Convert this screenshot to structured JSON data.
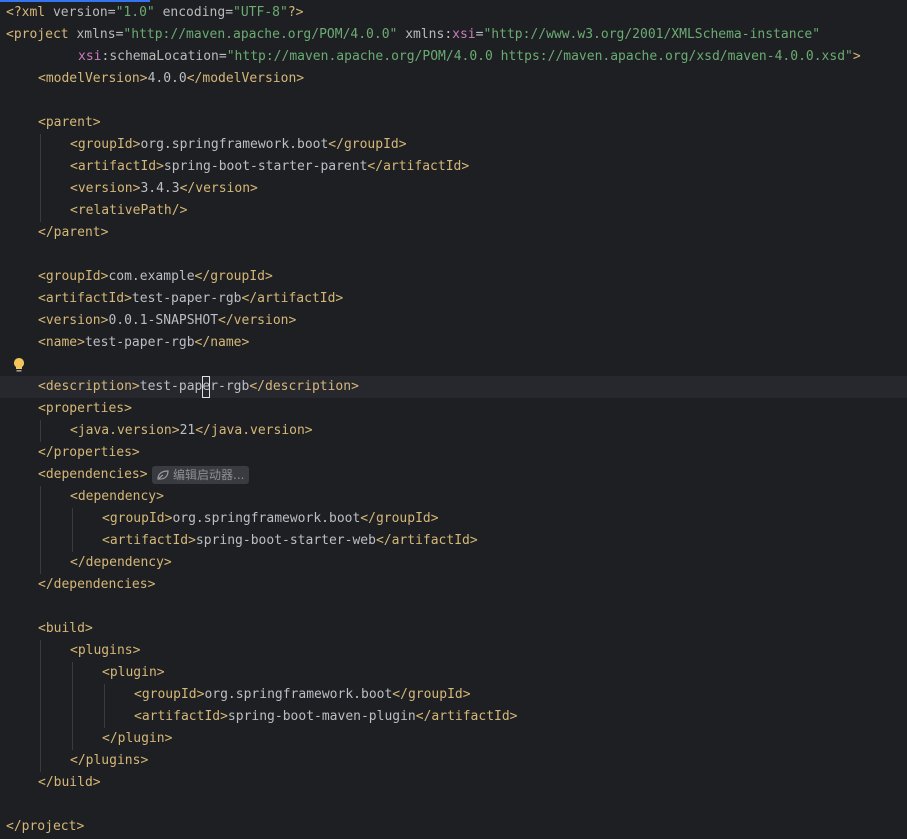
{
  "editor": {
    "file_lines": [
      {
        "indent": 0,
        "tokens": [
          {
            "t": "pi",
            "v": "<?"
          },
          {
            "t": "tag",
            "v": "xml "
          },
          {
            "t": "attr",
            "v": "version"
          },
          {
            "t": "txt",
            "v": "="
          },
          {
            "t": "str",
            "v": "\"1.0\""
          },
          {
            "t": "txt",
            "v": " "
          },
          {
            "t": "attr",
            "v": "encoding"
          },
          {
            "t": "txt",
            "v": "="
          },
          {
            "t": "str",
            "v": "\"UTF-8\""
          },
          {
            "t": "pi",
            "v": "?>"
          }
        ]
      },
      {
        "indent": 0,
        "tokens": [
          {
            "t": "tag",
            "v": "<project "
          },
          {
            "t": "attr",
            "v": "xmlns"
          },
          {
            "t": "txt",
            "v": "="
          },
          {
            "t": "str",
            "v": "\"http://maven.apache.org/POM/4.0.0\""
          },
          {
            "t": "txt",
            "v": " "
          },
          {
            "t": "attr",
            "v": "xmlns"
          },
          {
            "t": "txt",
            "v": ":"
          },
          {
            "t": "ns",
            "v": "xsi"
          },
          {
            "t": "txt",
            "v": "="
          },
          {
            "t": "str",
            "v": "\"http://www.w3.org/2001/XMLSchema-instance\""
          }
        ]
      },
      {
        "indent": 0,
        "pad": "         ",
        "tokens": [
          {
            "t": "ns",
            "v": "xsi"
          },
          {
            "t": "txt",
            "v": ":"
          },
          {
            "t": "attr",
            "v": "schemaLocation"
          },
          {
            "t": "txt",
            "v": "="
          },
          {
            "t": "str",
            "v": "\"http://maven.apache.org/POM/4.0.0 https://maven.apache.org/xsd/maven-4.0.0.xsd\""
          },
          {
            "t": "tag",
            "v": ">"
          }
        ]
      },
      {
        "indent": 1,
        "tokens": [
          {
            "t": "tag",
            "v": "<modelVersion>"
          },
          {
            "t": "txt",
            "v": "4.0.0"
          },
          {
            "t": "tag",
            "v": "</modelVersion>"
          }
        ]
      },
      {
        "indent": 0,
        "tokens": []
      },
      {
        "indent": 1,
        "tokens": [
          {
            "t": "tag",
            "v": "<parent>"
          }
        ]
      },
      {
        "indent": 2,
        "tokens": [
          {
            "t": "tag",
            "v": "<groupId>"
          },
          {
            "t": "txt",
            "v": "org.springframework.boot"
          },
          {
            "t": "tag",
            "v": "</groupId>"
          }
        ]
      },
      {
        "indent": 2,
        "tokens": [
          {
            "t": "tag",
            "v": "<artifactId>"
          },
          {
            "t": "txt",
            "v": "spring-boot-starter-parent"
          },
          {
            "t": "tag",
            "v": "</artifactId>"
          }
        ]
      },
      {
        "indent": 2,
        "tokens": [
          {
            "t": "tag",
            "v": "<version>"
          },
          {
            "t": "txt",
            "v": "3.4.3"
          },
          {
            "t": "tag",
            "v": "</version>"
          }
        ]
      },
      {
        "indent": 2,
        "tokens": [
          {
            "t": "tag",
            "v": "<relativePath/>"
          }
        ]
      },
      {
        "indent": 1,
        "tokens": [
          {
            "t": "tag",
            "v": "</parent>"
          }
        ]
      },
      {
        "indent": 0,
        "tokens": []
      },
      {
        "indent": 1,
        "tokens": [
          {
            "t": "tag",
            "v": "<groupId>"
          },
          {
            "t": "txt",
            "v": "com.example"
          },
          {
            "t": "tag",
            "v": "</groupId>"
          }
        ]
      },
      {
        "indent": 1,
        "tokens": [
          {
            "t": "tag",
            "v": "<artifactId>"
          },
          {
            "t": "txt",
            "v": "test-paper-rgb"
          },
          {
            "t": "tag",
            "v": "</artifactId>"
          }
        ]
      },
      {
        "indent": 1,
        "tokens": [
          {
            "t": "tag",
            "v": "<version>"
          },
          {
            "t": "txt",
            "v": "0.0.1-SNAPSHOT"
          },
          {
            "t": "tag",
            "v": "</version>"
          }
        ]
      },
      {
        "indent": 1,
        "tokens": [
          {
            "t": "tag",
            "v": "<name>"
          },
          {
            "t": "txt",
            "v": "test-paper-rgb"
          },
          {
            "t": "tag",
            "v": "</name>"
          }
        ]
      },
      {
        "indent": 0,
        "tokens": [],
        "bulb": true
      },
      {
        "indent": 1,
        "current": true,
        "tokens": [
          {
            "t": "tag",
            "v": "<description>"
          },
          {
            "t": "txt",
            "v": "test-pap"
          },
          {
            "t": "caret",
            "v": "e"
          },
          {
            "t": "txt",
            "v": "r-rgb"
          },
          {
            "t": "tag",
            "v": "</description>"
          }
        ]
      },
      {
        "indent": 1,
        "tokens": [
          {
            "t": "tag",
            "v": "<properties>"
          }
        ]
      },
      {
        "indent": 2,
        "tokens": [
          {
            "t": "tag",
            "v": "<java.version>"
          },
          {
            "t": "txt",
            "v": "21"
          },
          {
            "t": "tag",
            "v": "</java.version>"
          }
        ]
      },
      {
        "indent": 1,
        "tokens": [
          {
            "t": "tag",
            "v": "</properties>"
          }
        ]
      },
      {
        "indent": 1,
        "tokens": [
          {
            "t": "tag",
            "v": "<dependencies>"
          }
        ],
        "inlay": "编辑启动器..."
      },
      {
        "indent": 2,
        "tokens": [
          {
            "t": "tag",
            "v": "<dependency>"
          }
        ]
      },
      {
        "indent": 3,
        "tokens": [
          {
            "t": "tag",
            "v": "<groupId>"
          },
          {
            "t": "txt",
            "v": "org.springframework.boot"
          },
          {
            "t": "tag",
            "v": "</groupId>"
          }
        ]
      },
      {
        "indent": 3,
        "tokens": [
          {
            "t": "tag",
            "v": "<artifactId>"
          },
          {
            "t": "txt",
            "v": "spring-boot-starter-web"
          },
          {
            "t": "tag",
            "v": "</artifactId>"
          }
        ]
      },
      {
        "indent": 2,
        "tokens": [
          {
            "t": "tag",
            "v": "</dependency>"
          }
        ]
      },
      {
        "indent": 1,
        "tokens": [
          {
            "t": "tag",
            "v": "</dependencies>"
          }
        ]
      },
      {
        "indent": 0,
        "tokens": []
      },
      {
        "indent": 1,
        "tokens": [
          {
            "t": "tag",
            "v": "<build>"
          }
        ]
      },
      {
        "indent": 2,
        "tokens": [
          {
            "t": "tag",
            "v": "<plugins>"
          }
        ]
      },
      {
        "indent": 3,
        "tokens": [
          {
            "t": "tag",
            "v": "<plugin>"
          }
        ]
      },
      {
        "indent": 4,
        "tokens": [
          {
            "t": "tag",
            "v": "<groupId>"
          },
          {
            "t": "txt",
            "v": "org.springframework.boot"
          },
          {
            "t": "tag",
            "v": "</groupId>"
          }
        ]
      },
      {
        "indent": 4,
        "tokens": [
          {
            "t": "tag",
            "v": "<artifactId>"
          },
          {
            "t": "txt",
            "v": "spring-boot-maven-plugin"
          },
          {
            "t": "tag",
            "v": "</artifactId>"
          }
        ]
      },
      {
        "indent": 3,
        "tokens": [
          {
            "t": "tag",
            "v": "</plugin>"
          }
        ]
      },
      {
        "indent": 2,
        "tokens": [
          {
            "t": "tag",
            "v": "</plugins>"
          }
        ]
      },
      {
        "indent": 1,
        "tokens": [
          {
            "t": "tag",
            "v": "</build>"
          }
        ]
      },
      {
        "indent": 0,
        "tokens": []
      },
      {
        "indent": 0,
        "tokens": [
          {
            "t": "tag",
            "v": "</project>"
          }
        ]
      }
    ],
    "guides": [
      {
        "from": 6,
        "to": 9,
        "level": 1
      },
      {
        "from": 19,
        "to": 19,
        "level": 1
      },
      {
        "from": 22,
        "to": 25,
        "level": 1
      },
      {
        "from": 23,
        "to": 24,
        "level": 2
      },
      {
        "from": 29,
        "to": 34,
        "level": 1
      },
      {
        "from": 30,
        "to": 33,
        "level": 2
      },
      {
        "from": 31,
        "to": 32,
        "level": 3
      }
    ]
  },
  "icons": {
    "intention": "lightbulb-icon",
    "inlay": "edit-starters-icon"
  },
  "colors": {
    "background": "#1e1f22",
    "current_line": "#26282e",
    "tag": "#d5b778",
    "attribute": "#bababa",
    "namespace": "#c77dbb",
    "string": "#6aab73",
    "text": "#bcbec4",
    "bulb": "#f2c55c"
  }
}
